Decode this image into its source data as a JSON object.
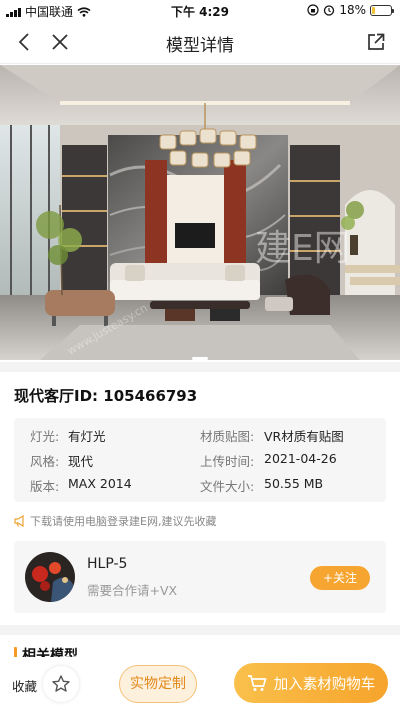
{
  "status_bar": {
    "carrier": "中国联通",
    "time": "下午 4:29",
    "battery": "18%",
    "battery_level": 0.18
  },
  "nav": {
    "title": "模型详情",
    "back_icon": "chevron-left-icon",
    "close_icon": "close-icon",
    "share_icon": "external-link-icon"
  },
  "hero": {
    "watermark": "建E网",
    "watermark_url": "www.justeasy.cn"
  },
  "model": {
    "title": "现代客厅ID: 105466793"
  },
  "info": {
    "light_label": "灯光:",
    "light_value": "有灯光",
    "material_label": "材质贴图:",
    "material_value": "VR材质有贴图",
    "style_label": "风格:",
    "style_value": "现代",
    "upload_label": "上传时间:",
    "upload_value": "2021-04-26",
    "version_label": "版本:",
    "version_value": "MAX 2014",
    "size_label": "文件大小:",
    "size_value": "50.55 MB"
  },
  "tip": {
    "text": "下载请使用电脑登录建E网,建议先收藏"
  },
  "author": {
    "name": "HLP-5",
    "subtitle": "需要合作请+VX",
    "follow_label": "+关注"
  },
  "related": {
    "title": "相关模型"
  },
  "bottom": {
    "favorite_label": "收藏",
    "custom_label": "实物定制",
    "cart_label": "加入素材购物车"
  },
  "colors": {
    "accent": "#f6a42c",
    "accent_light": "#fdf0dc"
  }
}
